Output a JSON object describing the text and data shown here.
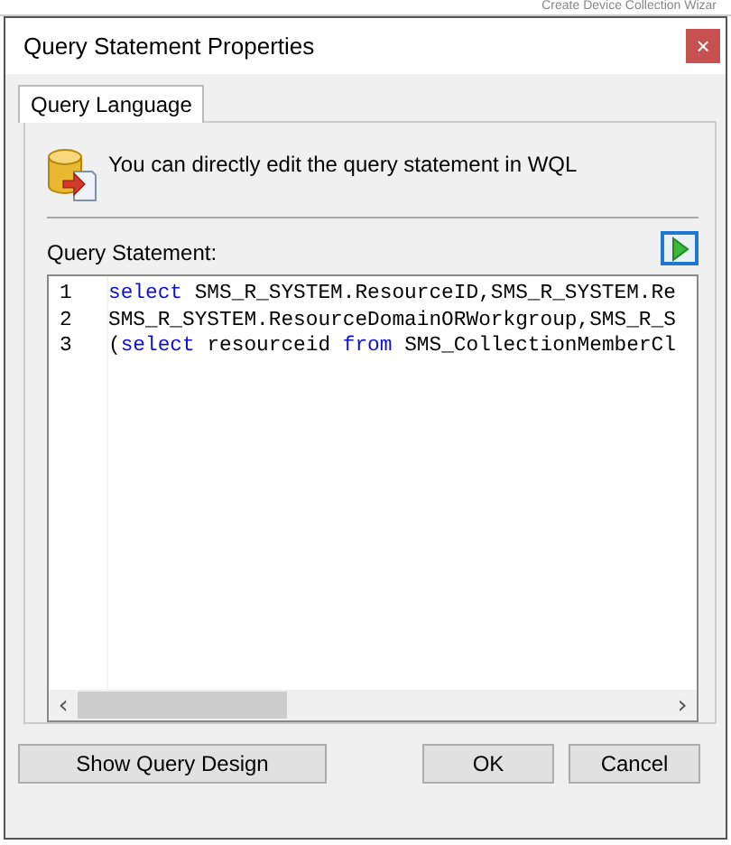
{
  "background_window": {
    "title": "Create Device Collection Wizar"
  },
  "window": {
    "title": "Query Statement Properties",
    "close": "×"
  },
  "tabs": [
    {
      "label": "Query Language",
      "selected": true
    }
  ],
  "info": {
    "text": "You can directly edit the query statement in WQL"
  },
  "query_statement": {
    "label": "Query Statement:",
    "lines": [
      {
        "number": "1",
        "tokens": [
          {
            "text": "select",
            "kind": "keyword"
          },
          {
            "text": " SMS_R_SYSTEM.ResourceID,SMS_R_SYSTEM.Re",
            "kind": "plain"
          }
        ]
      },
      {
        "number": "2",
        "tokens": [
          {
            "text": "SMS_R_SYSTEM.ResourceDomainORWorkgroup,SMS_R_S",
            "kind": "plain"
          }
        ]
      },
      {
        "number": "3",
        "tokens": [
          {
            "text": "(",
            "kind": "plain"
          },
          {
            "text": "select",
            "kind": "keyword"
          },
          {
            "text": " resourceid ",
            "kind": "plain"
          },
          {
            "text": "from",
            "kind": "keyword"
          },
          {
            "text": " SMS_CollectionMemberCl",
            "kind": "plain"
          }
        ]
      }
    ],
    "scroll_left": "‹",
    "scroll_right": "›"
  },
  "buttons": [
    {
      "label": "Show Query Design",
      "kind": "wide"
    },
    {
      "label": "OK",
      "kind": "normal"
    },
    {
      "label": "Cancel",
      "kind": "normal"
    }
  ]
}
